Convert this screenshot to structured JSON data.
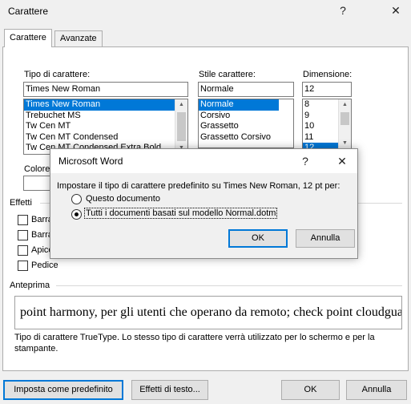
{
  "dialog": {
    "title": "Carattere",
    "help_glyph": "?",
    "close_glyph": "✕",
    "tabs": [
      {
        "label": "Carattere"
      },
      {
        "label": "Avanzate"
      }
    ]
  },
  "font": {
    "label": "Tipo di carattere:",
    "value": "Times New Roman",
    "items": [
      "Times New Roman",
      "Trebuchet MS",
      "Tw Cen MT",
      "Tw Cen MT Condensed",
      "Tw Cen MT Condensed Extra Bold"
    ],
    "selected": "Times New Roman"
  },
  "style": {
    "label": "Stile carattere:",
    "value": "Normale",
    "items": [
      "Normale",
      "Corsivo",
      "Grassetto",
      "Grassetto Corsivo"
    ],
    "selected": "Normale"
  },
  "size": {
    "label": "Dimensione:",
    "value": "12",
    "items": [
      "8",
      "9",
      "10",
      "11",
      "12"
    ],
    "selected": "12"
  },
  "color": {
    "label_partial": "Colore"
  },
  "effects": {
    "section_title": "Effetti",
    "checkboxes": [
      {
        "label": "Barra",
        "checked": false
      },
      {
        "label": "Barra",
        "checked": false
      },
      {
        "label": "Apice",
        "checked": false
      },
      {
        "label": "Pedice",
        "checked": false
      }
    ]
  },
  "preview": {
    "section_title": "Anteprima",
    "text": "point harmony, per gli utenti che operano da remoto; check point cloudguard, p",
    "description": "Tipo di carattere TrueType. Lo stesso tipo di carattere verrà utilizzato per lo schermo e per la stampante."
  },
  "buttons": {
    "set_default": "Imposta come predefinito",
    "text_effects": "Effetti di testo...",
    "ok": "OK",
    "cancel": "Annulla"
  },
  "modal": {
    "title": "Microsoft Word",
    "help_glyph": "?",
    "close_glyph": "✕",
    "prompt": "Impostare il tipo di carattere predefinito su Times New Roman, 12 pt per:",
    "options": [
      {
        "label": "Questo documento",
        "selected": false
      },
      {
        "label": "Tutti i documenti basati sul modello Normal.dotm",
        "selected": true
      }
    ],
    "ok": "OK",
    "cancel": "Annulla"
  },
  "colors": {
    "selection": "#0078d7",
    "focus_border": "#0078d7"
  }
}
